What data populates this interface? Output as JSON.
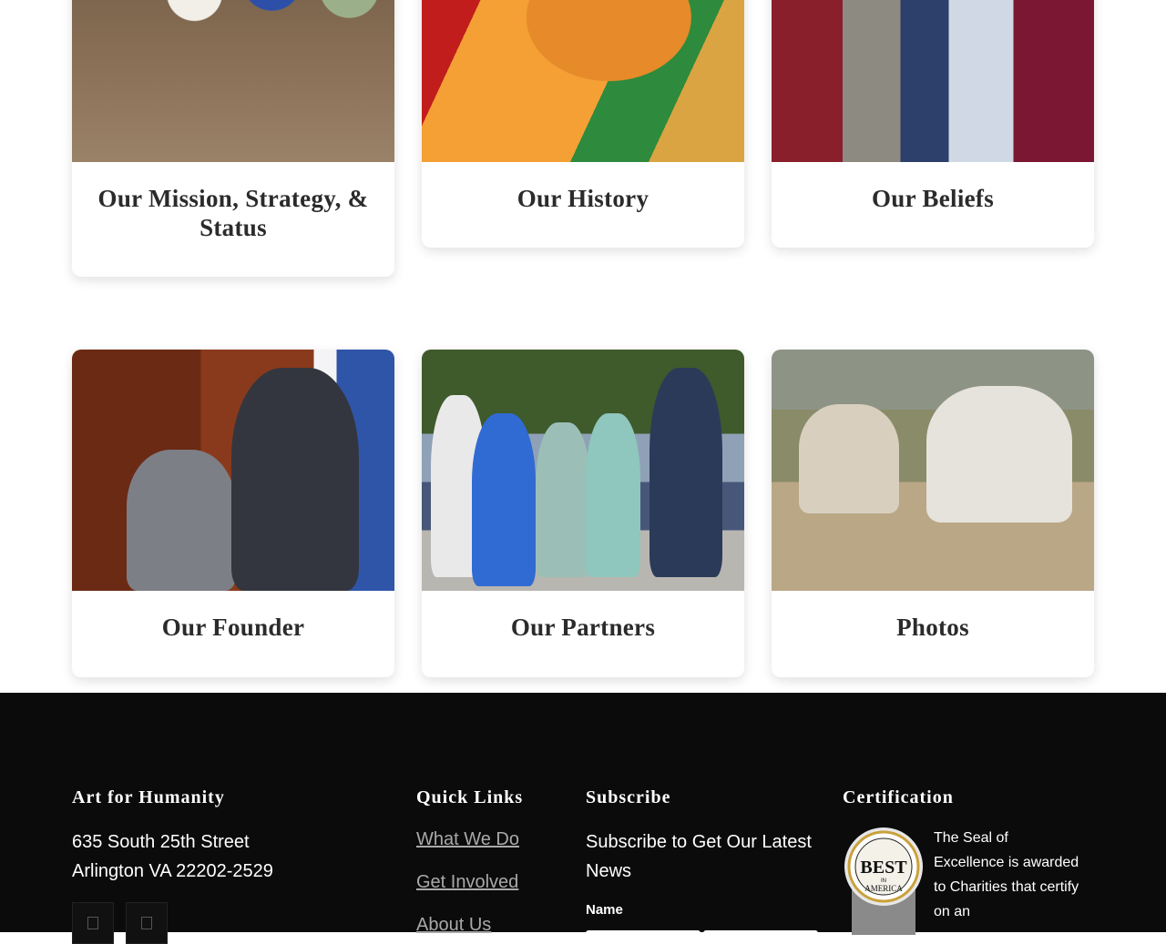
{
  "cards": [
    {
      "title": "Our Mission, Strategy, & Status"
    },
    {
      "title": "Our History"
    },
    {
      "title": "Our Beliefs"
    },
    {
      "title": "Our Founder"
    },
    {
      "title": "Our Partners"
    },
    {
      "title": "Photos"
    }
  ],
  "footer": {
    "org": {
      "heading": "Art for Humanity",
      "address_line1": "635 South 25th Street",
      "address_line2": "Arlington VA 22202-2529"
    },
    "quick_links": {
      "heading": "Quick Links",
      "items": [
        "What We Do",
        "Get Involved",
        "About Us"
      ]
    },
    "subscribe": {
      "heading": "Subscribe",
      "text": "Subscribe to Get Our Latest News",
      "name_label": "Name"
    },
    "certification": {
      "heading": "Certification",
      "text": "The Seal of Excellence is awarded to Charities that certify on an",
      "badge_text_top": "BEST",
      "badge_text_mid": "IN",
      "badge_text_bottom": "AMERICA"
    },
    "social_icons": [
      "facebook-icon",
      "instagram-icon"
    ]
  },
  "colors": {
    "footer_bg": "#0b0b0b",
    "link_gray": "#a9a9a9",
    "title_text": "#2b2b2b"
  }
}
